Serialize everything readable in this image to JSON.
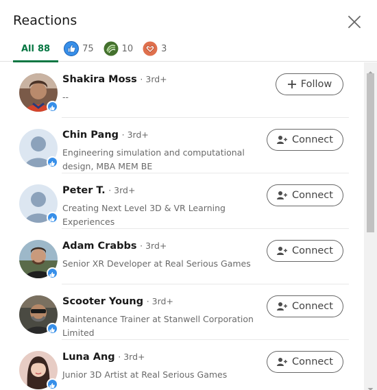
{
  "modal": {
    "title": "Reactions",
    "close_icon": "close-icon"
  },
  "tabs": [
    {
      "label": "All",
      "count": "88",
      "icon": null,
      "active": true
    },
    {
      "label": "",
      "count": "75",
      "icon": "like-icon",
      "active": false
    },
    {
      "label": "",
      "count": "10",
      "icon": "support-icon",
      "active": false
    },
    {
      "label": "",
      "count": "3",
      "icon": "love-icon",
      "active": false
    }
  ],
  "people": [
    {
      "name": "Shakira Moss",
      "degree": "· 3rd+",
      "headline": "--",
      "action": "Follow",
      "action_icon": "plus-icon",
      "avatar": "photo"
    },
    {
      "name": "Chin Pang",
      "degree": "· 3rd+",
      "headline": "Engineering simulation and computational design, MBA MEM BE",
      "action": "Connect",
      "action_icon": "add-person-icon",
      "avatar": "default"
    },
    {
      "name": "Peter T.",
      "degree": "· 3rd+",
      "headline": "Creating Next Level 3D & VR Learning Experiences",
      "action": "Connect",
      "action_icon": "add-person-icon",
      "avatar": "default"
    },
    {
      "name": "Adam Crabbs",
      "degree": "· 3rd+",
      "headline": "Senior XR Developer at Real Serious Games",
      "action": "Connect",
      "action_icon": "add-person-icon",
      "avatar": "photo"
    },
    {
      "name": "Scooter Young",
      "degree": "· 3rd+",
      "headline": "Maintenance Trainer at Stanwell Corporation Limited",
      "action": "Connect",
      "action_icon": "add-person-icon",
      "avatar": "photo"
    },
    {
      "name": "Luna Ang",
      "degree": "· 3rd+",
      "headline": "Junior 3D Artist at Real Serious Games",
      "action": "Connect",
      "action_icon": "add-person-icon",
      "avatar": "photo"
    }
  ],
  "colors": {
    "accent_green": "#057642",
    "like_blue": "#378fe9",
    "support_green": "#44712e",
    "love_red": "#df704d"
  }
}
